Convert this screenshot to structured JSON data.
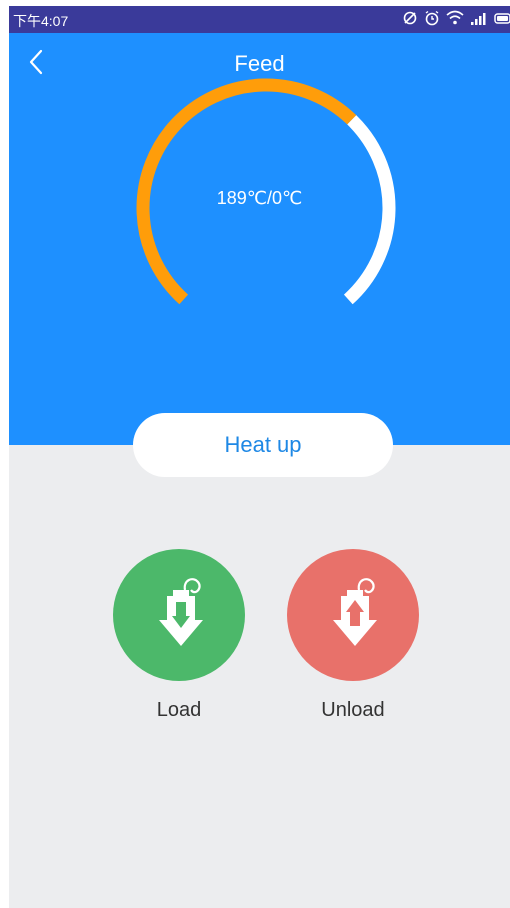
{
  "status": {
    "time": "下午4:07",
    "icons": [
      "sync-icon",
      "alarm-icon",
      "wifi-icon",
      "signal-icon",
      "battery-icon"
    ]
  },
  "header": {
    "title": "Feed",
    "back_icon": "chevron-left-icon"
  },
  "temperature": {
    "readout": "189℃/0℃",
    "gauge_progress": 0.66,
    "progress_color": "#ff9d0a",
    "track_color": "#ffffff"
  },
  "heat_button": {
    "label": "Heat up"
  },
  "actions": [
    {
      "label": "Load",
      "icon": "load-filament-icon",
      "color": "#4cb86a"
    },
    {
      "label": "Unload",
      "icon": "unload-filament-icon",
      "color": "#e8716a"
    }
  ],
  "colors": {
    "primary": "#1e90ff",
    "background": "#ecedef",
    "status_bar": "#3a3a9a"
  }
}
